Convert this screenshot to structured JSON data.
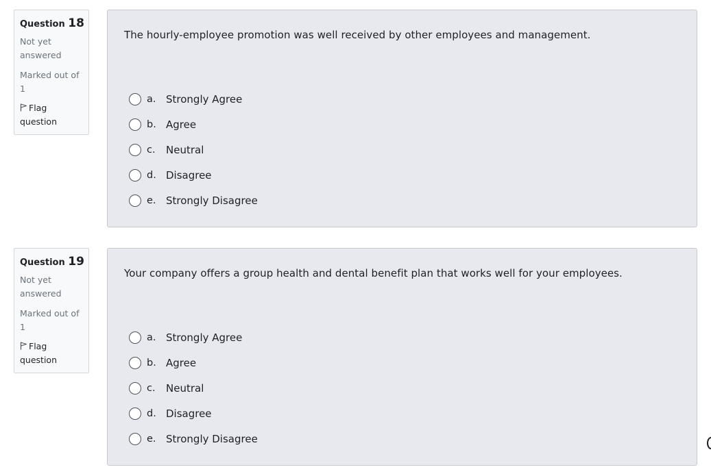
{
  "questions": [
    {
      "title_prefix": "Question",
      "number": "18",
      "state": "Not yet answered",
      "grade": "Marked out of 1",
      "flag_label": "Flag question",
      "text": "The hourly-employee promotion was well received by other employees and management.",
      "options": [
        {
          "letter": "a.",
          "label": "Strongly Agree"
        },
        {
          "letter": "b.",
          "label": "Agree"
        },
        {
          "letter": "c.",
          "label": "Neutral"
        },
        {
          "letter": "d.",
          "label": "Disagree"
        },
        {
          "letter": "e.",
          "label": "Strongly Disagree"
        }
      ]
    },
    {
      "title_prefix": "Question",
      "number": "19",
      "state": "Not yet answered",
      "grade": "Marked out of 1",
      "flag_label": "Flag question",
      "text": "Your company offers a group health and dental benefit plan that works well for your employees.",
      "options": [
        {
          "letter": "a.",
          "label": "Strongly Agree"
        },
        {
          "letter": "b.",
          "label": "Agree"
        },
        {
          "letter": "c.",
          "label": "Neutral"
        },
        {
          "letter": "d.",
          "label": "Disagree"
        },
        {
          "letter": "e.",
          "label": "Strongly Disagree"
        }
      ]
    }
  ],
  "icons": {
    "flag": "flag-icon",
    "radio": "radio-unchecked-icon"
  },
  "colors": {
    "panel_bg": "#e7e9ee",
    "info_bg": "#f8f9fa",
    "muted_text": "#6a737b",
    "text": "#1d2125"
  }
}
